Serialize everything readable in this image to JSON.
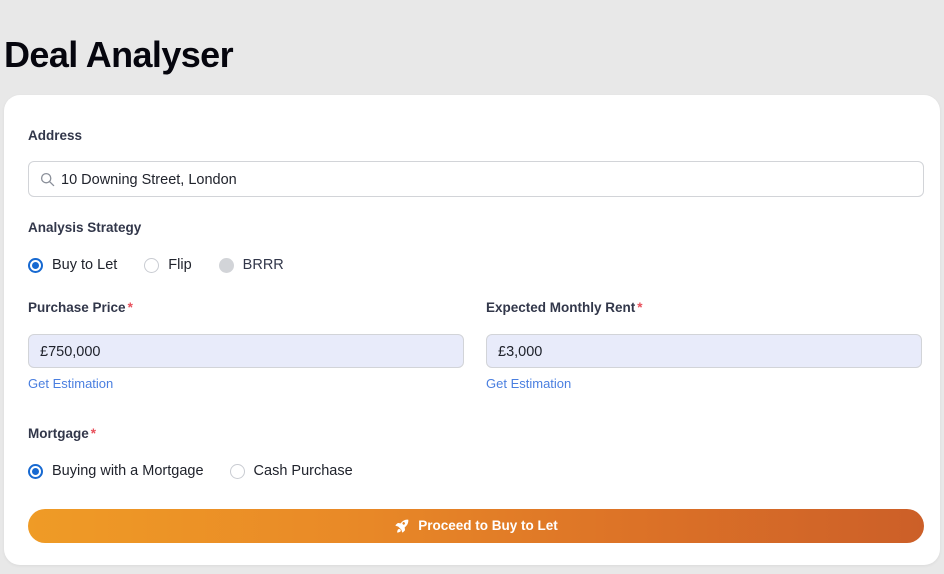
{
  "page": {
    "title": "Deal Analyser",
    "background_color": "#e8e8e8",
    "card_color": "#ffffff"
  },
  "form": {
    "address": {
      "label": "Address",
      "value": "10 Downing Street, London",
      "icon": "search-icon"
    },
    "strategy": {
      "label": "Analysis Strategy",
      "options": [
        {
          "label": "Buy to Let",
          "state": "selected"
        },
        {
          "label": "Flip",
          "state": "unselected"
        },
        {
          "label": "BRRR",
          "state": "disabled"
        }
      ]
    },
    "purchase_price": {
      "label": "Purchase Price",
      "required_marker": "*",
      "value": "£750,000",
      "helper_link": "Get Estimation"
    },
    "monthly_rent": {
      "label": "Expected Monthly Rent",
      "required_marker": "*",
      "value": "£3,000",
      "helper_link": "Get Estimation"
    },
    "mortgage": {
      "label": "Mortgage",
      "required_marker": "*",
      "options": [
        {
          "label": "Buying with a Mortgage",
          "state": "selected"
        },
        {
          "label": "Cash Purchase",
          "state": "unselected"
        }
      ]
    },
    "submit": {
      "label": "Proceed to Buy to Let",
      "icon": "rocket-icon",
      "gradient_start": "#ef9b26",
      "gradient_end": "#cc5f28"
    }
  },
  "colors": {
    "accent_blue": "#1769d1",
    "link_blue": "#4a7fe0",
    "required_red": "#e8505b",
    "input_fill": "#e8ebfa"
  }
}
